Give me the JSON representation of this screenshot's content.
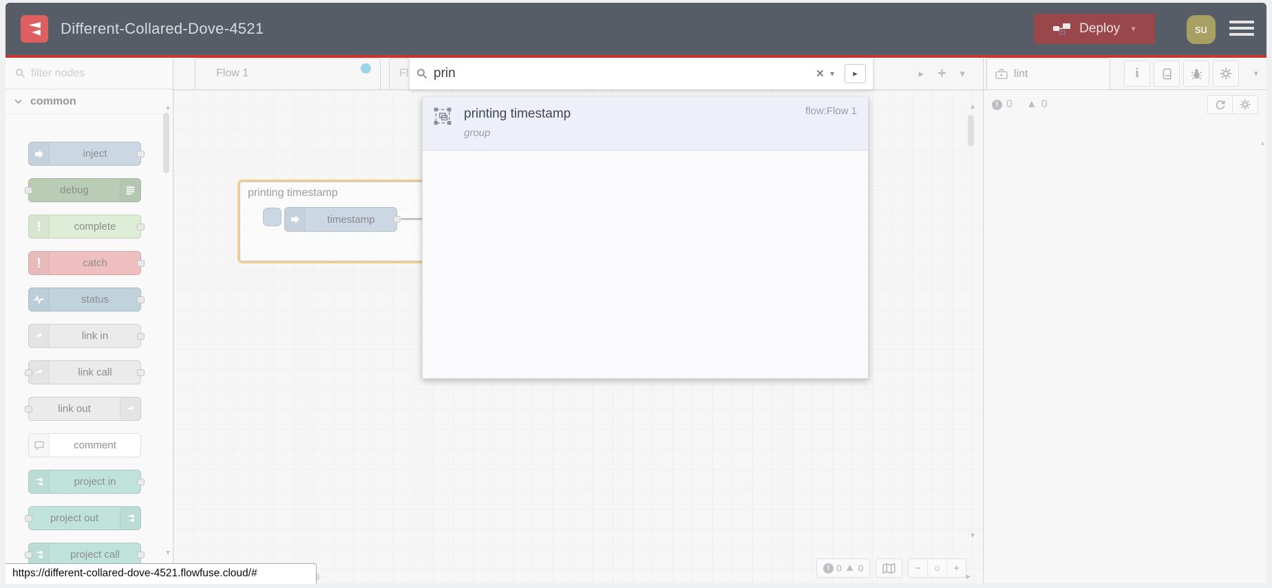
{
  "header": {
    "title": "Different-Collared-Dove-4521",
    "deploy_label": "Deploy",
    "avatar": "su"
  },
  "palette": {
    "filter_placeholder": "filter nodes",
    "category_label": "common",
    "nodes": [
      {
        "label": "inject",
        "color": "#a6bbcf",
        "icon": "arrow",
        "icon_side": "left",
        "ports": "out"
      },
      {
        "label": "debug",
        "color": "#87a980",
        "icon": "list",
        "icon_side": "right",
        "ports": "in"
      },
      {
        "label": "complete",
        "color": "#c6e0b8",
        "icon": "exclam",
        "icon_side": "left",
        "ports": "out"
      },
      {
        "label": "catch",
        "color": "#e49191",
        "icon": "exclam",
        "icon_side": "left",
        "ports": "out"
      },
      {
        "label": "status",
        "color": "#93b4c4",
        "icon": "pulse",
        "icon_side": "left",
        "ports": "out"
      },
      {
        "label": "link in",
        "color": "#dddddd",
        "icon": "link",
        "icon_side": "left",
        "ports": "out"
      },
      {
        "label": "link call",
        "color": "#dddddd",
        "icon": "link",
        "icon_side": "left",
        "ports": "both"
      },
      {
        "label": "link out",
        "color": "#dddddd",
        "icon": "link",
        "icon_side": "right",
        "ports": "in"
      },
      {
        "label": "comment",
        "color": "#ffffff",
        "icon": "comment",
        "icon_side": "left",
        "ports": "none"
      },
      {
        "label": "project in",
        "color": "#92cfc0",
        "icon": "project",
        "icon_side": "left",
        "ports": "out"
      },
      {
        "label": "project out",
        "color": "#92cfc0",
        "icon": "project",
        "icon_side": "right",
        "ports": "in"
      },
      {
        "label": "project call",
        "color": "#92cfc0",
        "icon": "project",
        "icon_side": "left",
        "ports": "both"
      }
    ]
  },
  "workspace": {
    "active_tab": "Flow 1",
    "partial_tab": "Fl",
    "group_label": "printing timestamp",
    "node_label": "timestamp",
    "footer": {
      "errors": "0",
      "warnings": "0"
    },
    "zoom_out": "−",
    "zoom_reset": "○",
    "zoom_in": "+"
  },
  "search": {
    "query": "prin",
    "result_title": "printing timestamp",
    "result_type": "group",
    "result_flow": "flow:Flow 1"
  },
  "sidebar": {
    "tab_label": "lint",
    "errors": "0",
    "warnings": "0"
  },
  "status_bar": {
    "url": "https://different-collared-dove-4521.flowfuse.cloud/#"
  },
  "colors": {
    "header_bg": "#565d66",
    "accent_red_line": "#cb3434",
    "logo_red": "#dd5f5f",
    "deploy_bg": "#9a474c",
    "avatar_bg": "#a89f63",
    "tab_dot_blue": "#55b7d8",
    "group_outline_orange": "#eda544",
    "result_row_bg": "#edf0f8"
  }
}
